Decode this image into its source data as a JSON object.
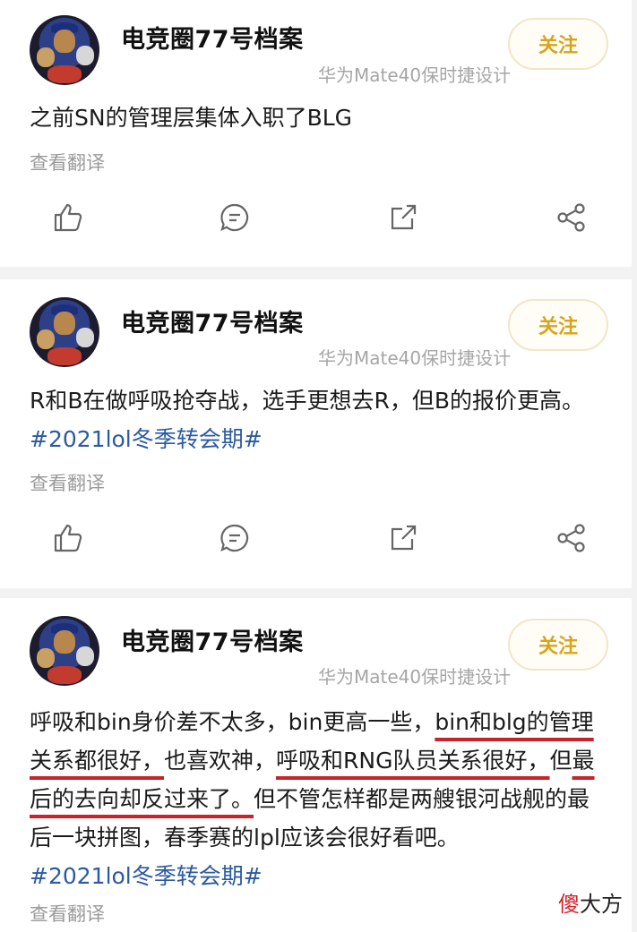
{
  "posts": [
    {
      "author": "电竞圈77号档案",
      "device": "华为Mate40保时捷设计",
      "follow_label": "关注",
      "text": "之前SN的管理层集体入职了BLG",
      "translate_label": "查看翻译"
    },
    {
      "author": "电竞圈77号档案",
      "device": "华为Mate40保时捷设计",
      "follow_label": "关注",
      "text": "R和B在做呼吸抢夺战，选手更想去R，但B的报价更高。",
      "hashtag": "#2021lol冬季转会期#",
      "translate_label": "查看翻译"
    },
    {
      "author": "电竞圈77号档案",
      "device": "华为Mate40保时捷设计",
      "follow_label": "关注",
      "text_parts": [
        "呼吸和bin身价差不太多，bin更高一些，",
        "bin和blg的管理",
        "关系都很好，",
        "也喜欢神，",
        "呼吸和RNG队员关系很好，",
        "但",
        "最后的去向却反过来了。",
        "但不管怎样都是两艘银河战舰的最后一块拼图，春季赛的lpl应该会很好看吧。"
      ],
      "hashtag": "#2021lol冬季转会期#",
      "translate_label": "查看翻译"
    }
  ],
  "icons": [
    "like-icon",
    "comment-icon",
    "share-edit-icon",
    "share-icon"
  ],
  "colors": {
    "follow": "#d9a41c",
    "hashtag": "#2c5aa0",
    "underline": "#c8232c"
  },
  "watermark": {
    "first": "傻",
    "rest": "大方"
  }
}
